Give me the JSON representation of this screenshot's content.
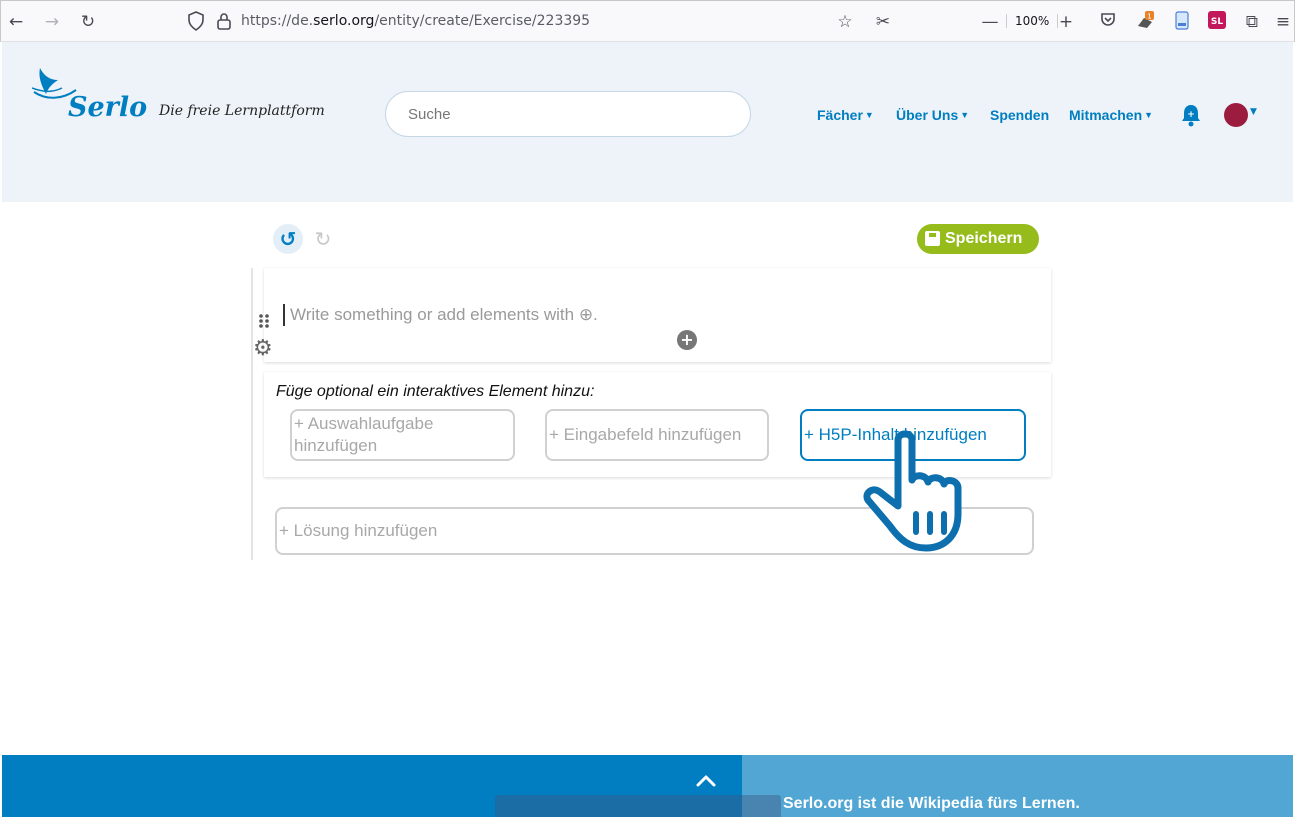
{
  "browser": {
    "url_prefix": "https://de.",
    "url_domain": "serlo.org",
    "url_path": "/entity/create/Exercise/223395",
    "zoom": "100%",
    "extension_badge": "1",
    "extension_sl": "SL"
  },
  "header": {
    "logo_text": "Serlo",
    "logo_subtitle": "Die freie Lernplattform",
    "search_placeholder": "Suche",
    "nav": {
      "faecher": "Fächer",
      "ueber_uns": "Über Uns",
      "spenden": "Spenden",
      "mitmachen": "Mitmachen"
    }
  },
  "editor": {
    "save_label": "Speichern",
    "placeholder": "Write something or add elements with ⊕.",
    "interactive_label": "Füge optional ein interaktives Element hinzu:",
    "options": [
      {
        "label": "Auswahlaufgabe hinzufügen"
      },
      {
        "label": "Eingabefeld hinzufügen"
      },
      {
        "label": "H5P-Inhalt hinzufügen"
      }
    ],
    "solution_label": "Lösung hinzufügen"
  },
  "footer": {
    "tagline": "Serlo.org ist die Wikipedia fürs Lernen."
  },
  "colors": {
    "brand_blue": "#007ec1",
    "save_green": "#95bc1a",
    "header_bg": "#edf3f8"
  }
}
